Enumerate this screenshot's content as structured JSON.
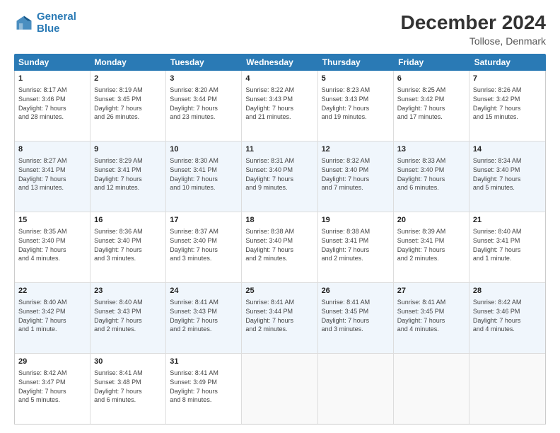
{
  "header": {
    "logo_line1": "General",
    "logo_line2": "Blue",
    "month": "December 2024",
    "location": "Tollose, Denmark"
  },
  "weekdays": [
    "Sunday",
    "Monday",
    "Tuesday",
    "Wednesday",
    "Thursday",
    "Friday",
    "Saturday"
  ],
  "rows": [
    {
      "alt": false,
      "cells": [
        {
          "day": "1",
          "lines": [
            "Sunrise: 8:17 AM",
            "Sunset: 3:46 PM",
            "Daylight: 7 hours",
            "and 28 minutes."
          ]
        },
        {
          "day": "2",
          "lines": [
            "Sunrise: 8:19 AM",
            "Sunset: 3:45 PM",
            "Daylight: 7 hours",
            "and 26 minutes."
          ]
        },
        {
          "day": "3",
          "lines": [
            "Sunrise: 8:20 AM",
            "Sunset: 3:44 PM",
            "Daylight: 7 hours",
            "and 23 minutes."
          ]
        },
        {
          "day": "4",
          "lines": [
            "Sunrise: 8:22 AM",
            "Sunset: 3:43 PM",
            "Daylight: 7 hours",
            "and 21 minutes."
          ]
        },
        {
          "day": "5",
          "lines": [
            "Sunrise: 8:23 AM",
            "Sunset: 3:43 PM",
            "Daylight: 7 hours",
            "and 19 minutes."
          ]
        },
        {
          "day": "6",
          "lines": [
            "Sunrise: 8:25 AM",
            "Sunset: 3:42 PM",
            "Daylight: 7 hours",
            "and 17 minutes."
          ]
        },
        {
          "day": "7",
          "lines": [
            "Sunrise: 8:26 AM",
            "Sunset: 3:42 PM",
            "Daylight: 7 hours",
            "and 15 minutes."
          ]
        }
      ]
    },
    {
      "alt": true,
      "cells": [
        {
          "day": "8",
          "lines": [
            "Sunrise: 8:27 AM",
            "Sunset: 3:41 PM",
            "Daylight: 7 hours",
            "and 13 minutes."
          ]
        },
        {
          "day": "9",
          "lines": [
            "Sunrise: 8:29 AM",
            "Sunset: 3:41 PM",
            "Daylight: 7 hours",
            "and 12 minutes."
          ]
        },
        {
          "day": "10",
          "lines": [
            "Sunrise: 8:30 AM",
            "Sunset: 3:41 PM",
            "Daylight: 7 hours",
            "and 10 minutes."
          ]
        },
        {
          "day": "11",
          "lines": [
            "Sunrise: 8:31 AM",
            "Sunset: 3:40 PM",
            "Daylight: 7 hours",
            "and 9 minutes."
          ]
        },
        {
          "day": "12",
          "lines": [
            "Sunrise: 8:32 AM",
            "Sunset: 3:40 PM",
            "Daylight: 7 hours",
            "and 7 minutes."
          ]
        },
        {
          "day": "13",
          "lines": [
            "Sunrise: 8:33 AM",
            "Sunset: 3:40 PM",
            "Daylight: 7 hours",
            "and 6 minutes."
          ]
        },
        {
          "day": "14",
          "lines": [
            "Sunrise: 8:34 AM",
            "Sunset: 3:40 PM",
            "Daylight: 7 hours",
            "and 5 minutes."
          ]
        }
      ]
    },
    {
      "alt": false,
      "cells": [
        {
          "day": "15",
          "lines": [
            "Sunrise: 8:35 AM",
            "Sunset: 3:40 PM",
            "Daylight: 7 hours",
            "and 4 minutes."
          ]
        },
        {
          "day": "16",
          "lines": [
            "Sunrise: 8:36 AM",
            "Sunset: 3:40 PM",
            "Daylight: 7 hours",
            "and 3 minutes."
          ]
        },
        {
          "day": "17",
          "lines": [
            "Sunrise: 8:37 AM",
            "Sunset: 3:40 PM",
            "Daylight: 7 hours",
            "and 3 minutes."
          ]
        },
        {
          "day": "18",
          "lines": [
            "Sunrise: 8:38 AM",
            "Sunset: 3:40 PM",
            "Daylight: 7 hours",
            "and 2 minutes."
          ]
        },
        {
          "day": "19",
          "lines": [
            "Sunrise: 8:38 AM",
            "Sunset: 3:41 PM",
            "Daylight: 7 hours",
            "and 2 minutes."
          ]
        },
        {
          "day": "20",
          "lines": [
            "Sunrise: 8:39 AM",
            "Sunset: 3:41 PM",
            "Daylight: 7 hours",
            "and 2 minutes."
          ]
        },
        {
          "day": "21",
          "lines": [
            "Sunrise: 8:40 AM",
            "Sunset: 3:41 PM",
            "Daylight: 7 hours",
            "and 1 minute."
          ]
        }
      ]
    },
    {
      "alt": true,
      "cells": [
        {
          "day": "22",
          "lines": [
            "Sunrise: 8:40 AM",
            "Sunset: 3:42 PM",
            "Daylight: 7 hours",
            "and 1 minute."
          ]
        },
        {
          "day": "23",
          "lines": [
            "Sunrise: 8:40 AM",
            "Sunset: 3:43 PM",
            "Daylight: 7 hours",
            "and 2 minutes."
          ]
        },
        {
          "day": "24",
          "lines": [
            "Sunrise: 8:41 AM",
            "Sunset: 3:43 PM",
            "Daylight: 7 hours",
            "and 2 minutes."
          ]
        },
        {
          "day": "25",
          "lines": [
            "Sunrise: 8:41 AM",
            "Sunset: 3:44 PM",
            "Daylight: 7 hours",
            "and 2 minutes."
          ]
        },
        {
          "day": "26",
          "lines": [
            "Sunrise: 8:41 AM",
            "Sunset: 3:45 PM",
            "Daylight: 7 hours",
            "and 3 minutes."
          ]
        },
        {
          "day": "27",
          "lines": [
            "Sunrise: 8:41 AM",
            "Sunset: 3:45 PM",
            "Daylight: 7 hours",
            "and 4 minutes."
          ]
        },
        {
          "day": "28",
          "lines": [
            "Sunrise: 8:42 AM",
            "Sunset: 3:46 PM",
            "Daylight: 7 hours",
            "and 4 minutes."
          ]
        }
      ]
    },
    {
      "alt": false,
      "cells": [
        {
          "day": "29",
          "lines": [
            "Sunrise: 8:42 AM",
            "Sunset: 3:47 PM",
            "Daylight: 7 hours",
            "and 5 minutes."
          ]
        },
        {
          "day": "30",
          "lines": [
            "Sunrise: 8:41 AM",
            "Sunset: 3:48 PM",
            "Daylight: 7 hours",
            "and 6 minutes."
          ]
        },
        {
          "day": "31",
          "lines": [
            "Sunrise: 8:41 AM",
            "Sunset: 3:49 PM",
            "Daylight: 7 hours",
            "and 8 minutes."
          ]
        },
        {
          "day": "",
          "lines": []
        },
        {
          "day": "",
          "lines": []
        },
        {
          "day": "",
          "lines": []
        },
        {
          "day": "",
          "lines": []
        }
      ]
    }
  ]
}
